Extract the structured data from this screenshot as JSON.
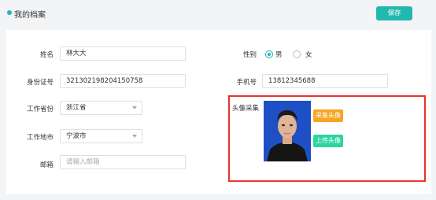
{
  "header": {
    "title": "我的档案",
    "save_label": "保存"
  },
  "form": {
    "name_label": "姓名",
    "name_value": "林大大",
    "gender_label": "性别",
    "gender_options": [
      "男",
      "女"
    ],
    "gender_selected": "男",
    "id_label": "身份证号",
    "id_value": "321302198204150758",
    "phone_label": "手机号",
    "phone_value": "13812345688",
    "province_label": "工作省份",
    "province_value": "浙江省",
    "city_label": "工作地市",
    "city_value": "宁波市",
    "email_label": "邮箱",
    "email_placeholder": "请输入邮箱"
  },
  "avatar": {
    "label": "头像采集",
    "capture_label": "采集头像",
    "upload_label": "上传头像"
  },
  "colors": {
    "accent": "#1cb7b7",
    "save": "#21b9ad",
    "capture": "#f5a623",
    "upload": "#2ed3a0",
    "highlight": "#e8322e"
  }
}
